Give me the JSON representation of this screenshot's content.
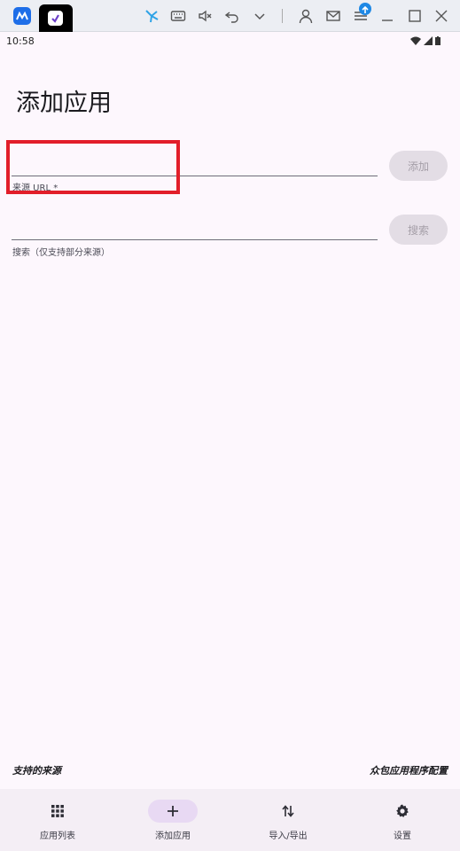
{
  "status_bar": {
    "time": "10:58"
  },
  "page": {
    "title": "添加应用"
  },
  "source_url": {
    "label": "来源 URL *",
    "value": ""
  },
  "add_button": {
    "label": "添加"
  },
  "search": {
    "label": "搜索（仅支持部分来源）",
    "value": ""
  },
  "search_button": {
    "label": "搜索"
  },
  "footer": {
    "supported_sources": "支持的来源",
    "crowdsourced_config": "众包应用程序配置"
  },
  "bottom_nav": {
    "items": [
      {
        "label": "应用列表",
        "icon": "grid-icon"
      },
      {
        "label": "添加应用",
        "icon": "plus-icon"
      },
      {
        "label": "导入/导出",
        "icon": "import-export-icon"
      },
      {
        "label": "设置",
        "icon": "gear-icon"
      }
    ]
  },
  "colors": {
    "background": "#fdf7fd",
    "highlight": "#e21e2a",
    "nav_active": "#e8d9f3"
  }
}
